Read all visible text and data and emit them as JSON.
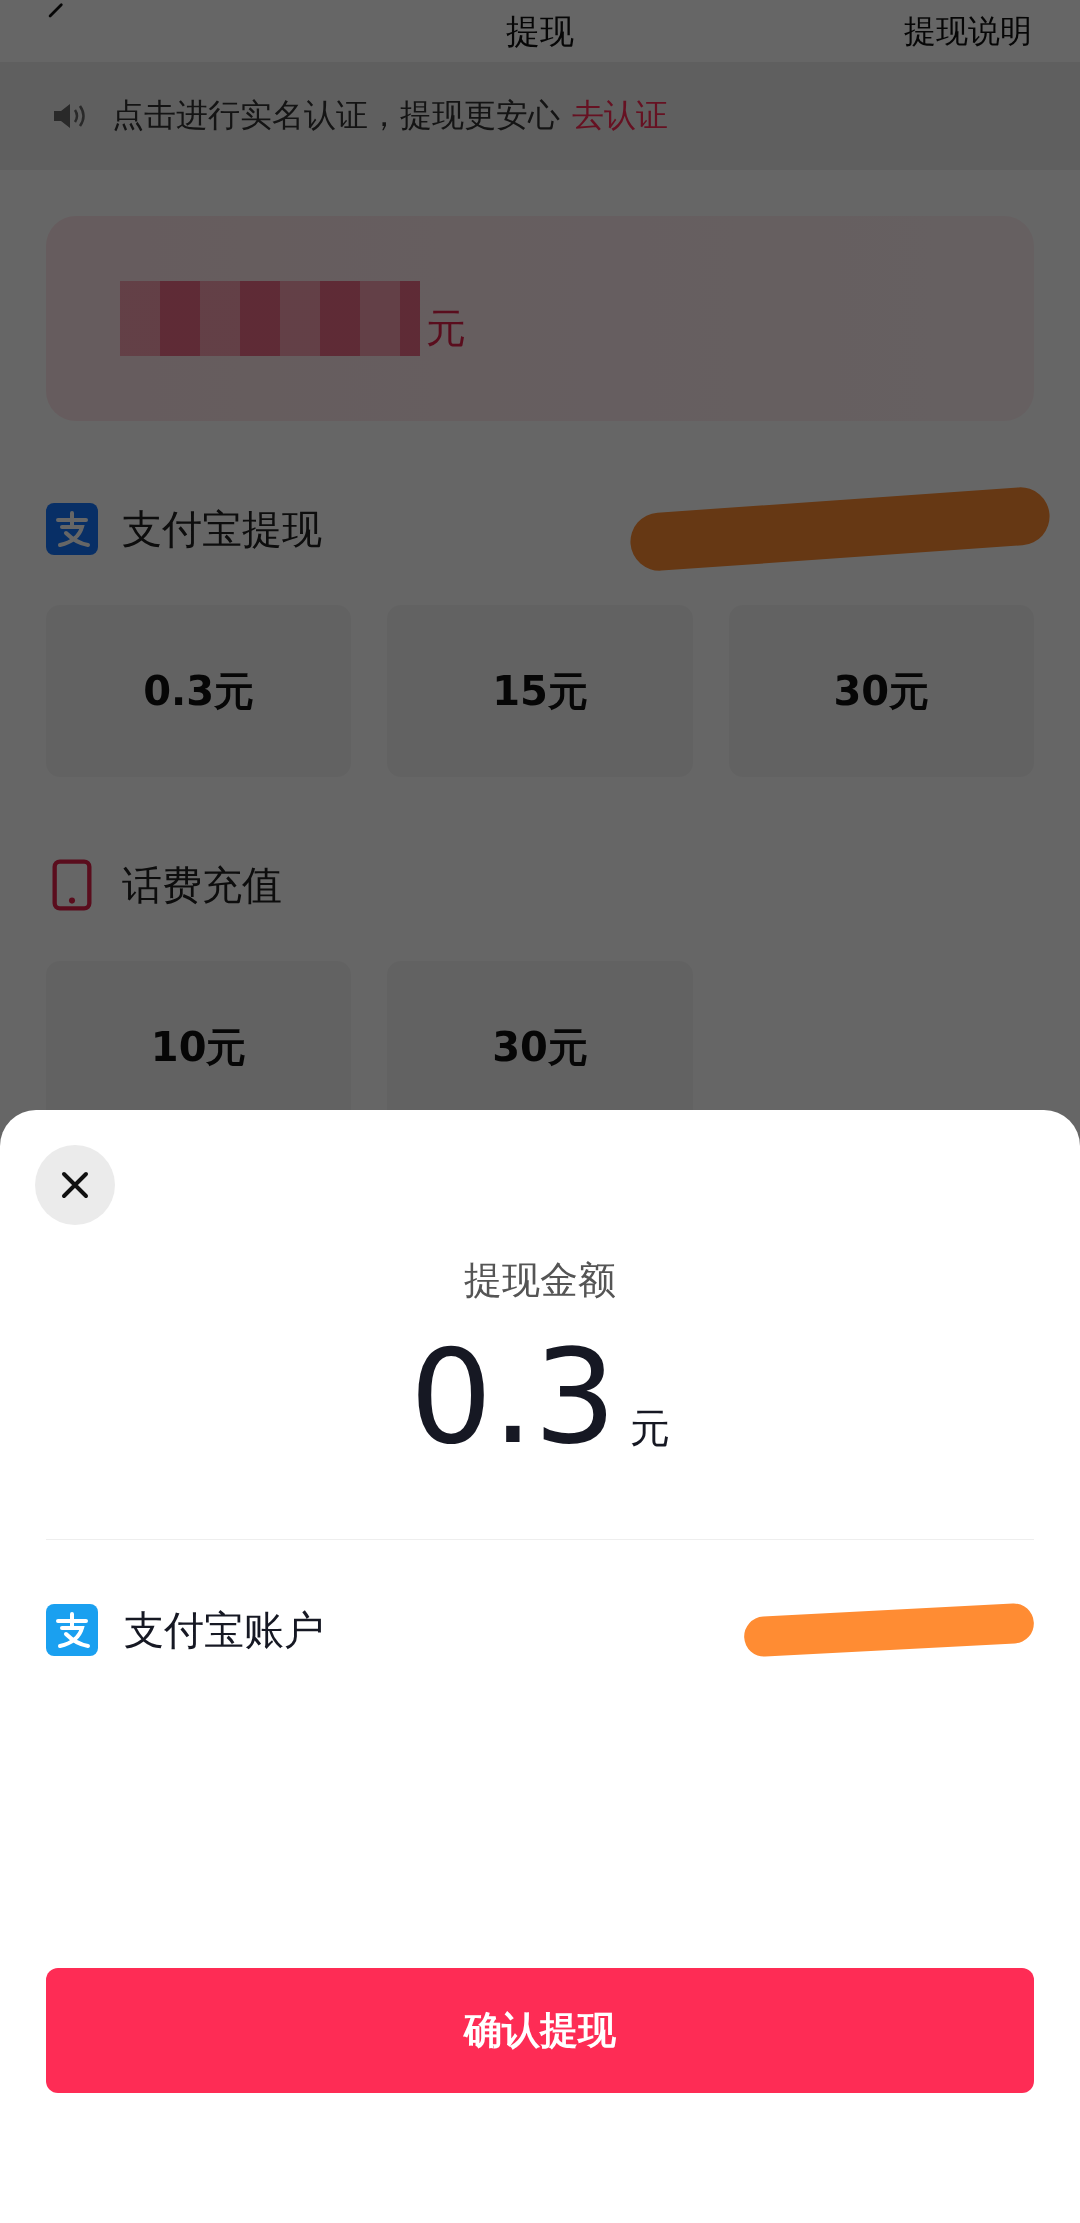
{
  "header": {
    "title": "提现",
    "help_link": "提现说明"
  },
  "notice": {
    "text": "点击进行实名认证，提现更安心",
    "link": "去认证"
  },
  "balance": {
    "unit": "元"
  },
  "sections": [
    {
      "kind": "alipay",
      "title": "支付宝提现",
      "options": [
        {
          "label": "0.3元"
        },
        {
          "label": "15元"
        },
        {
          "label": "30元"
        }
      ]
    },
    {
      "kind": "phone",
      "title": "话费充值",
      "options": [
        {
          "label": "10元"
        },
        {
          "label": "30元"
        }
      ]
    }
  ],
  "sheet": {
    "title": "提现金额",
    "amount": "0.3",
    "unit": "元",
    "account_label": "支付宝账户",
    "confirm": "确认提现"
  }
}
